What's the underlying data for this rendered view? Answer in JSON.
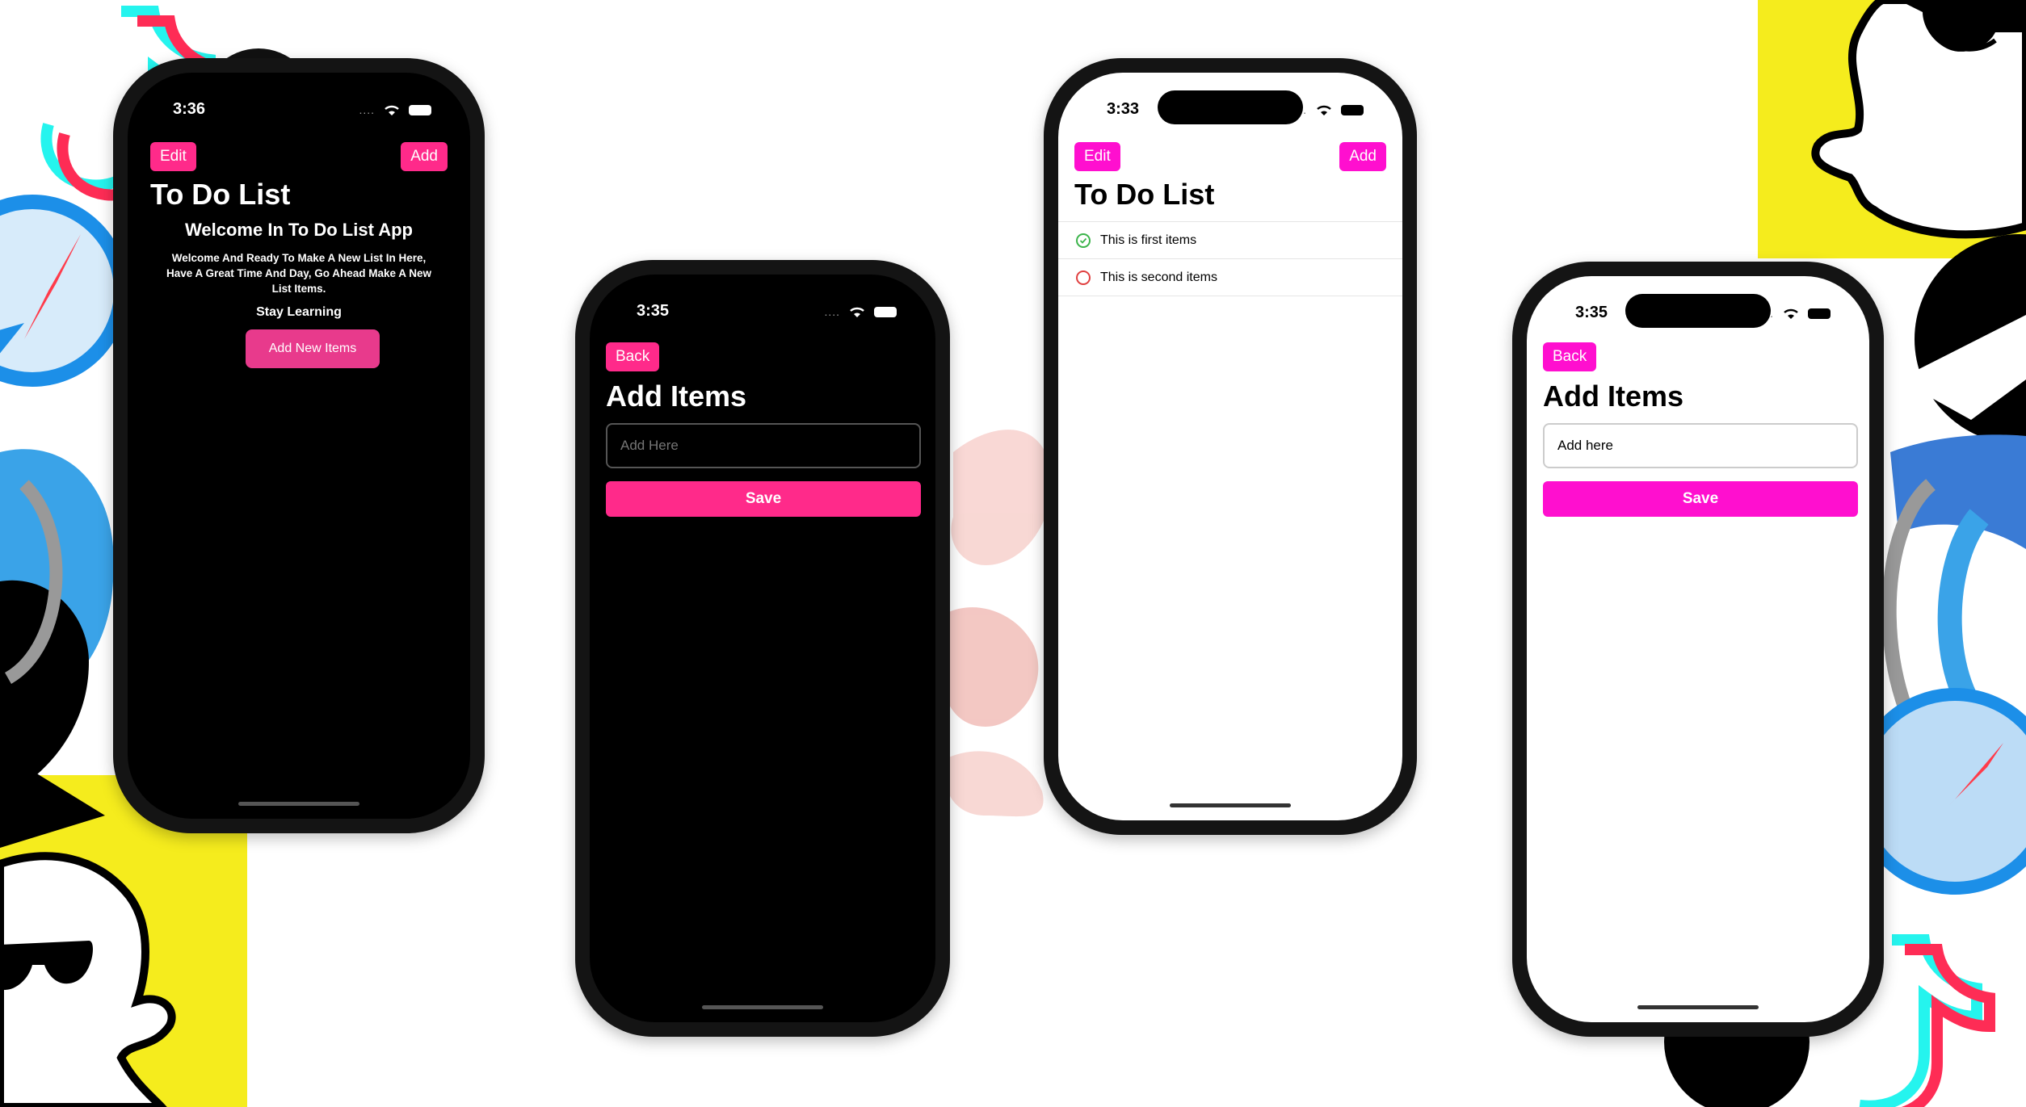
{
  "colors": {
    "accent_pink": "#ff2a8a",
    "accent_magenta": "#ff0fcf",
    "check_green": "#3cb44b",
    "circle_red": "#e04040"
  },
  "background_icons": [
    "tiktok-icon",
    "snapchat-icon",
    "safari-icon",
    "telegram-icon",
    "threads-icon"
  ],
  "phone1": {
    "time": "3:36",
    "edit": "Edit",
    "add": "Add",
    "title": "To Do List",
    "welcome_heading": "Welcome In To Do List App",
    "welcome_body": "Welcome And Ready To Make A New List In Here, Have A Great Time And Day, Go Ahead Make A New List Items.",
    "stay": "Stay Learning",
    "add_new": "Add New Items"
  },
  "phone2": {
    "time": "3:35",
    "back": "Back",
    "title": "Add Items",
    "placeholder": "Add Here",
    "save": "Save"
  },
  "phone3": {
    "time": "3:33",
    "edit": "Edit",
    "add": "Add",
    "title": "To Do List",
    "items": [
      {
        "label": "This is first items",
        "done": true
      },
      {
        "label": "This is second items",
        "done": false
      }
    ]
  },
  "phone4": {
    "time": "3:35",
    "back": "Back",
    "title": "Add Items",
    "value": "Add here",
    "save": "Save"
  }
}
